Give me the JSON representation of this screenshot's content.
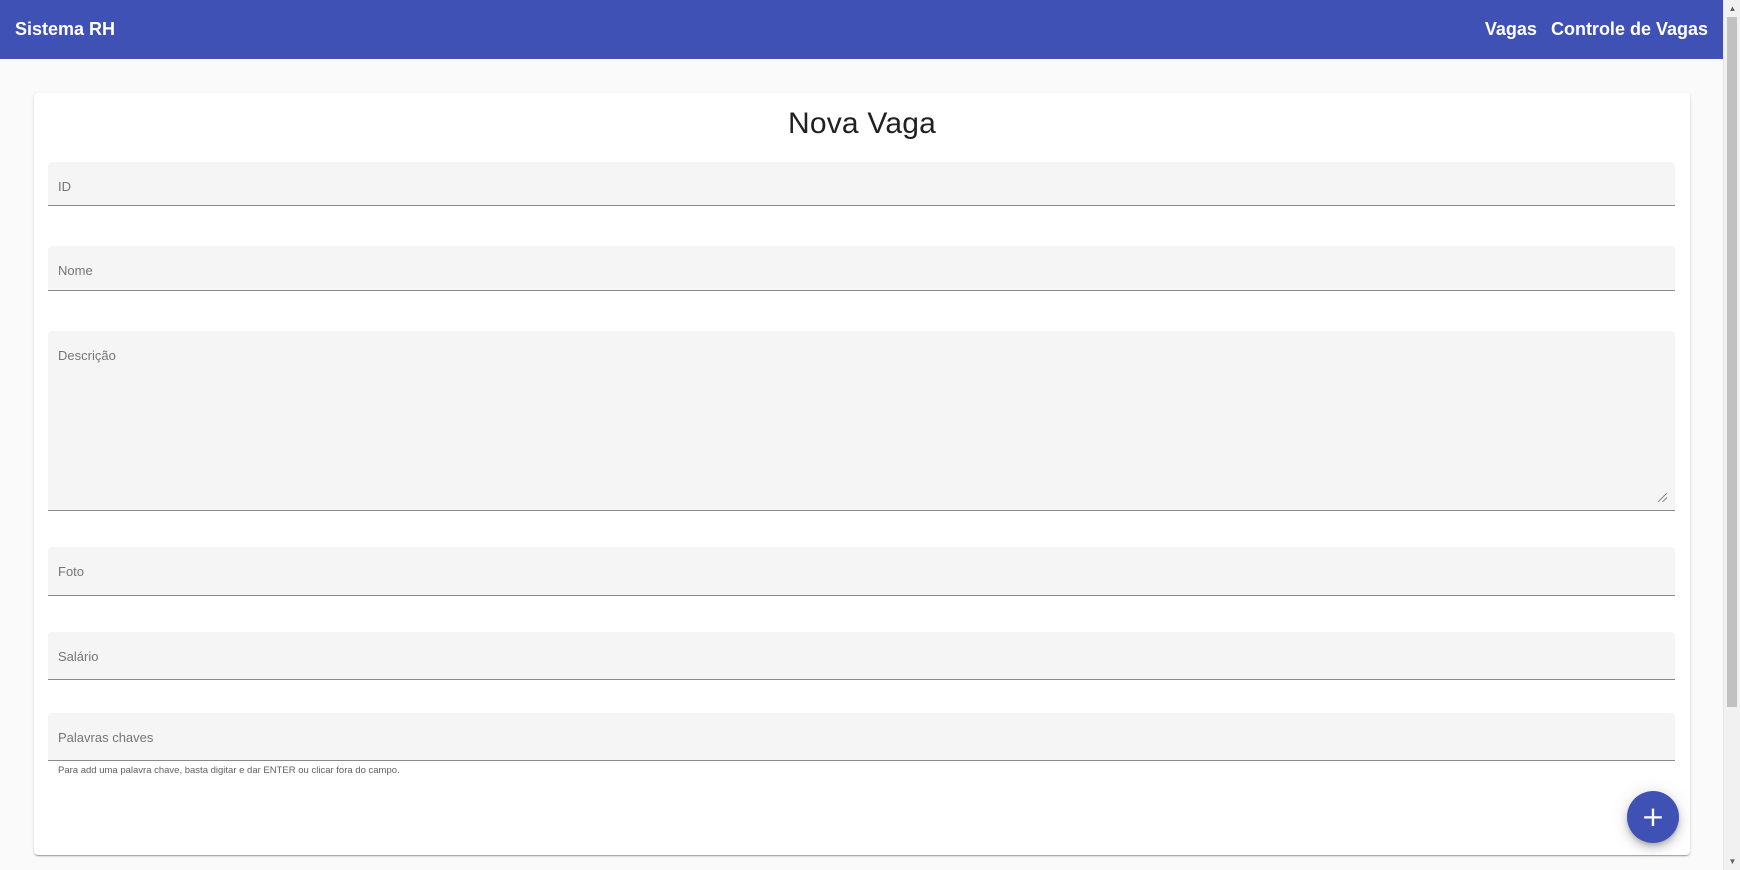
{
  "toolbar": {
    "app_title": "Sistema RH",
    "nav": [
      {
        "label": "Vagas"
      },
      {
        "label": "Controle de Vagas"
      }
    ]
  },
  "form": {
    "title": "Nova Vaga",
    "fields": {
      "id": {
        "label": "ID"
      },
      "nome": {
        "label": "Nome"
      },
      "descricao": {
        "label": "Descrição"
      },
      "foto": {
        "label": "Foto"
      },
      "salario": {
        "label": "Salário"
      },
      "palavras_chaves": {
        "label": "Palavras chaves"
      }
    },
    "hint": "Para add uma palavra chave, basta digitar e dar ENTER ou clicar fora do campo.",
    "add_button": {
      "icon": "plus-icon",
      "glyph": "+"
    }
  },
  "colors": {
    "primary": "#3f51b5",
    "field_background": "#f5f5f5",
    "page_background": "#fafafa"
  }
}
